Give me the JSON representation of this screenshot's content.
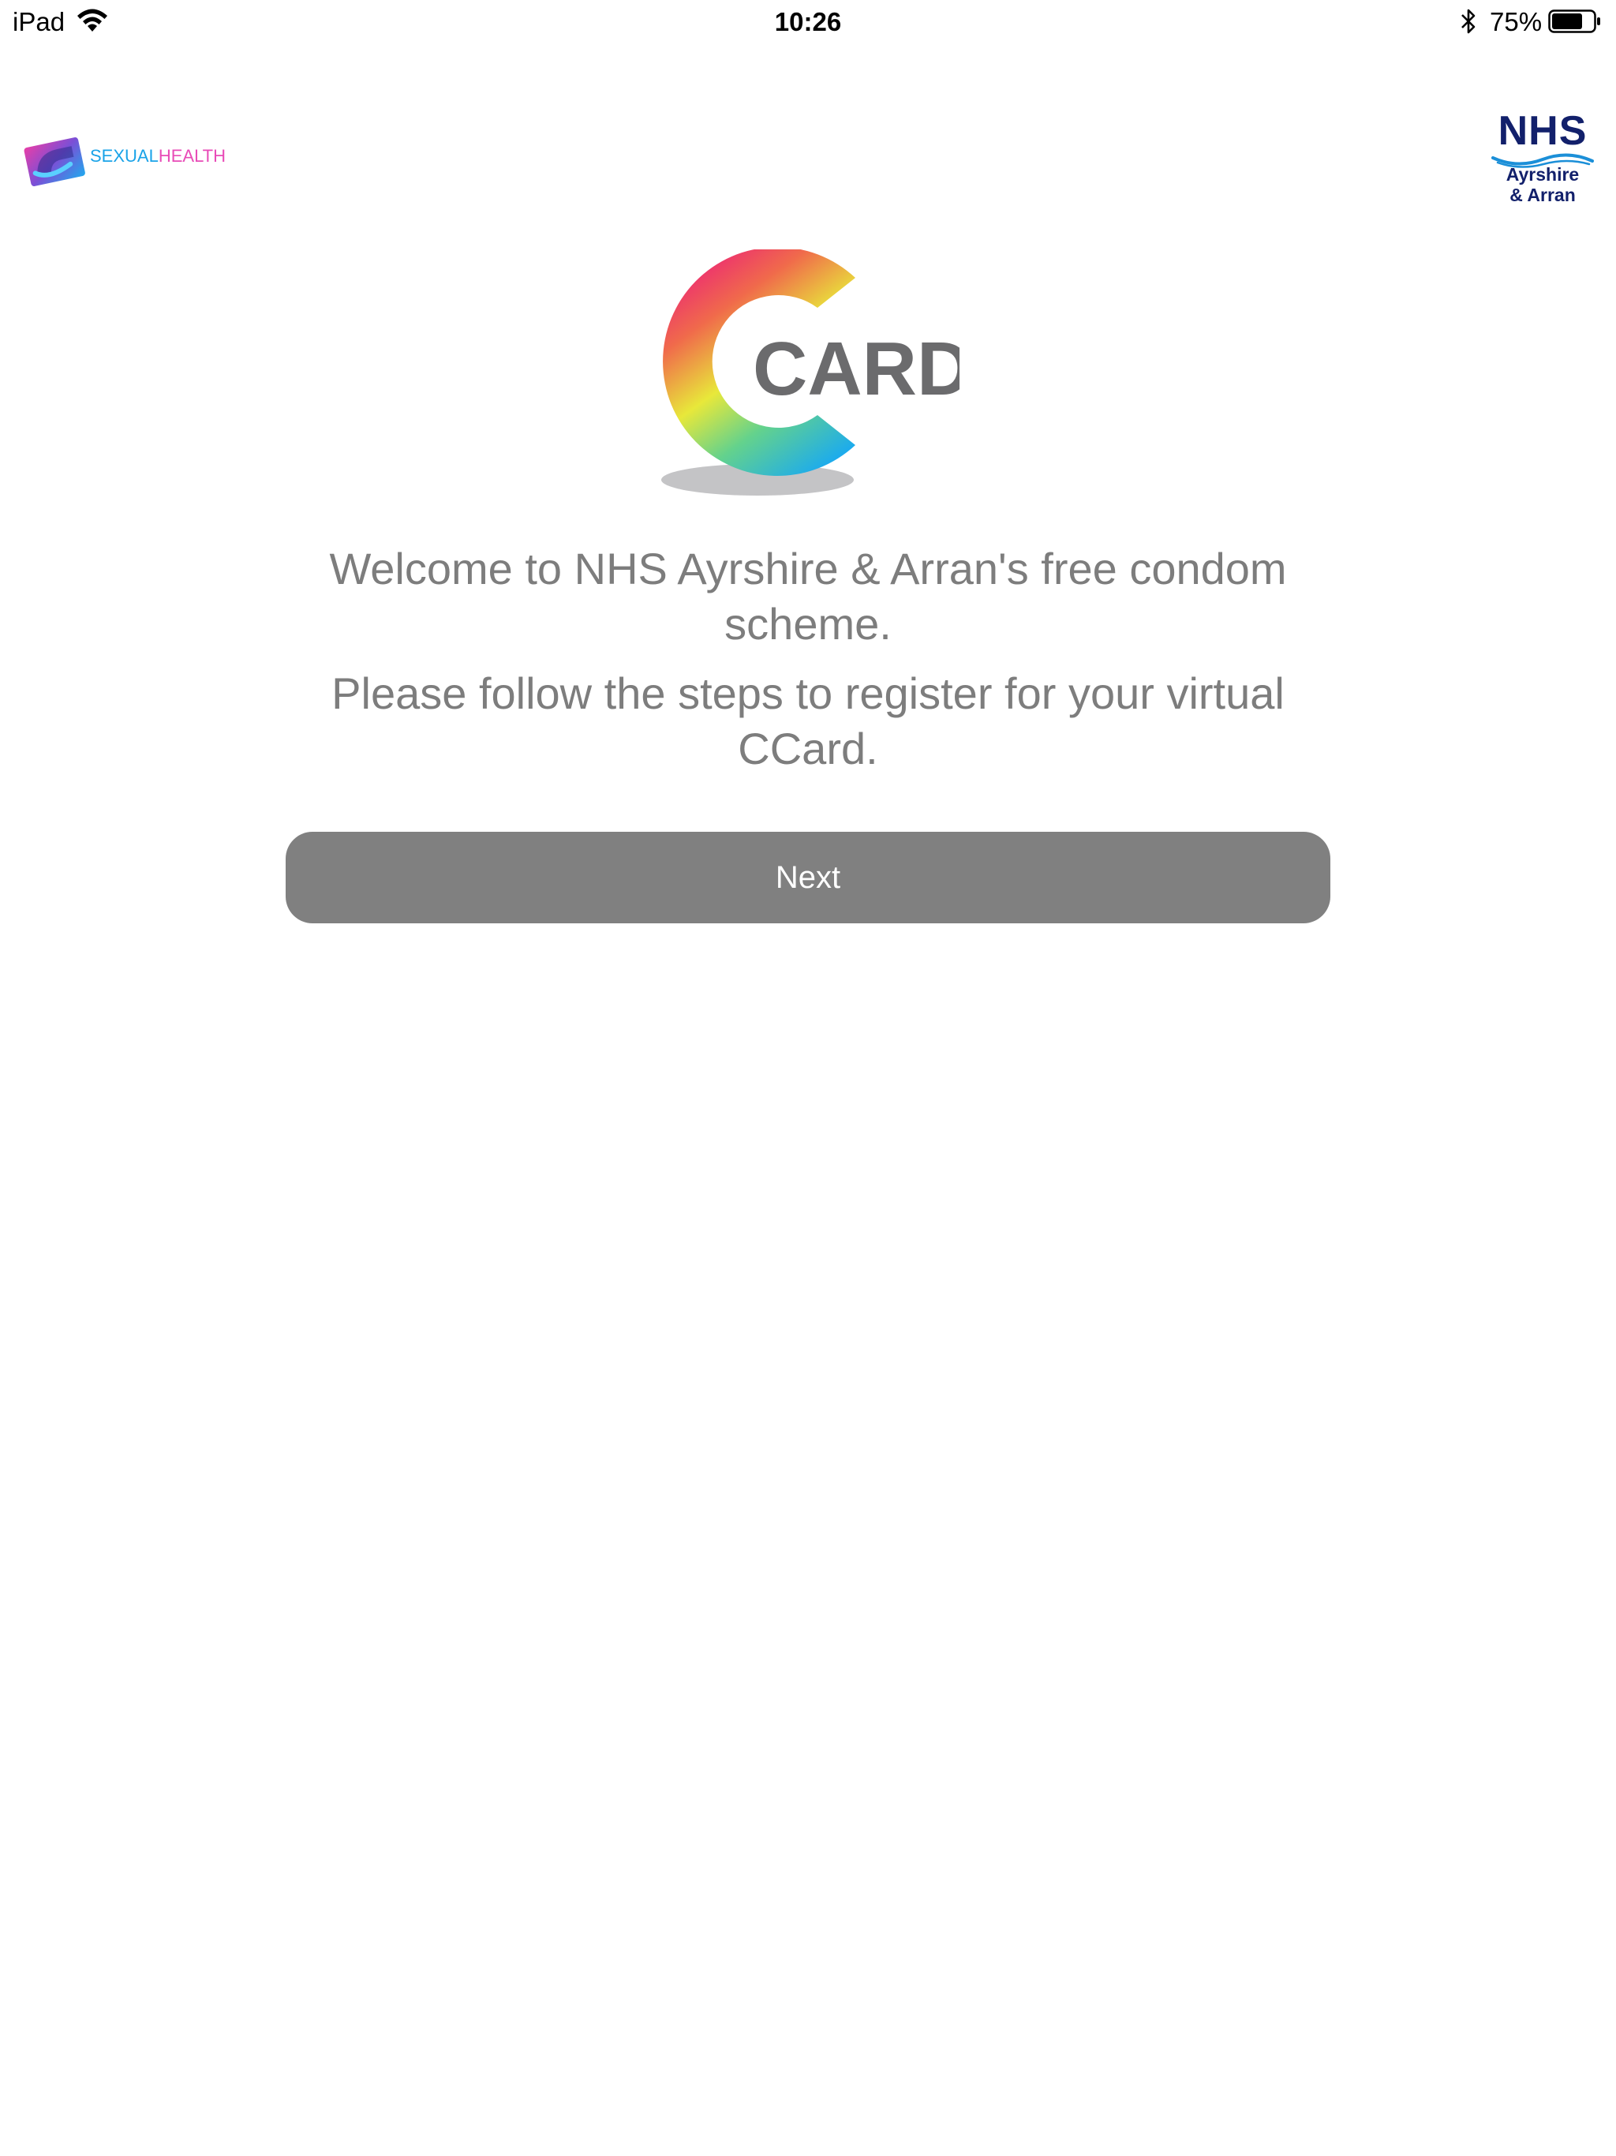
{
  "status_bar": {
    "device": "iPad",
    "time": "10:26",
    "battery_percent": "75%",
    "battery_level": 0.75,
    "icons": [
      "wifi-icon",
      "bluetooth-icon",
      "battery-icon"
    ]
  },
  "header": {
    "sexual_health_logo": {
      "text_part1": "SEXUAL",
      "text_part2": "HEALTH",
      "colors": {
        "blue": "#1aa3e8",
        "pink": "#e84bb7"
      }
    },
    "nhs_logo": {
      "word": "NHS",
      "line1": "Ayrshire",
      "line2": "& Arran",
      "color": "#12206b"
    }
  },
  "ccard_logo": {
    "word": "CARD",
    "text_color": "#6b6b6d"
  },
  "main": {
    "welcome_text": "Welcome to NHS Ayrshire & Arran's free condom scheme.",
    "instruction_text": "Please follow the steps to register for your virtual CCard.",
    "next_label": "Next",
    "button_color": "#808080"
  }
}
